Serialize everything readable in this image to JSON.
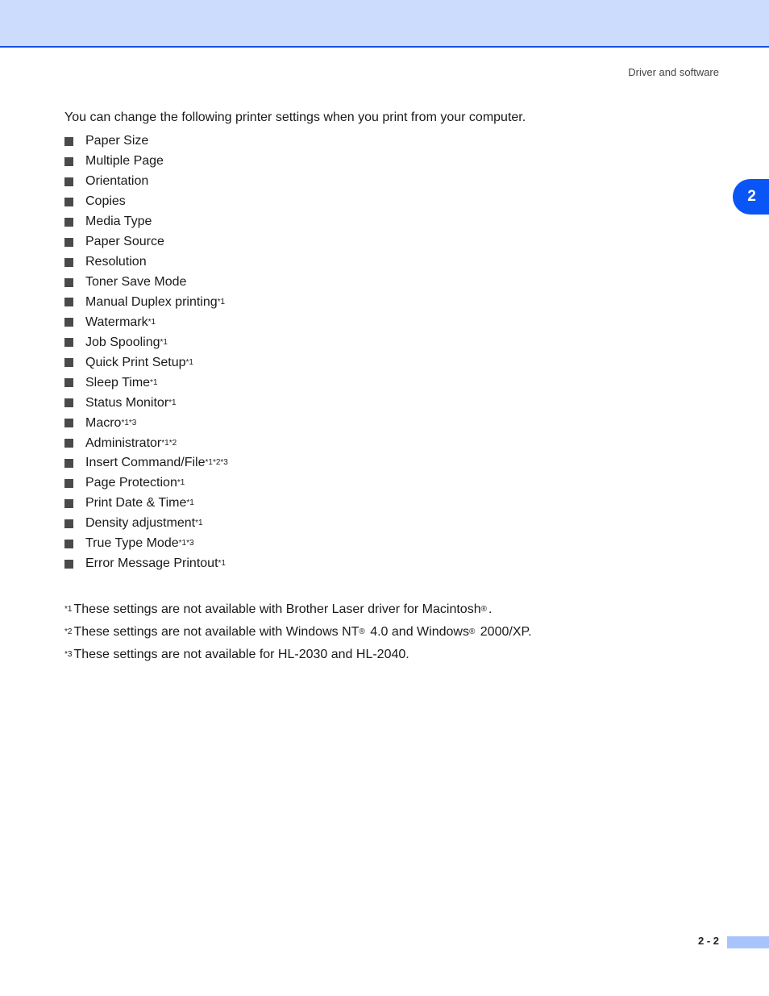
{
  "header": {
    "running_head": "Driver and software",
    "chapter_tab": "2"
  },
  "intro": "You can change the following printer settings when you print from your computer.",
  "settings": [
    {
      "label": "Paper Size",
      "notes": ""
    },
    {
      "label": "Multiple Page",
      "notes": ""
    },
    {
      "label": "Orientation",
      "notes": ""
    },
    {
      "label": "Copies",
      "notes": ""
    },
    {
      "label": "Media Type",
      "notes": ""
    },
    {
      "label": "Paper Source",
      "notes": ""
    },
    {
      "label": "Resolution",
      "notes": ""
    },
    {
      "label": "Toner Save Mode",
      "notes": ""
    },
    {
      "label": "Manual Duplex printing",
      "notes": "*1"
    },
    {
      "label": "Watermark",
      "notes": "*1"
    },
    {
      "label": "Job Spooling",
      "notes": "*1"
    },
    {
      "label": "Quick Print Setup",
      "notes": "*1"
    },
    {
      "label": "Sleep Time",
      "notes": "*1"
    },
    {
      "label": "Status Monitor",
      "notes": "*1"
    },
    {
      "label": "Macro",
      "notes": "*1*3"
    },
    {
      "label": "Administrator",
      "notes": "*1*2"
    },
    {
      "label": "Insert Command/File",
      "notes": "*1*2*3"
    },
    {
      "label": "Page Protection",
      "notes": "*1"
    },
    {
      "label": "Print Date & Time",
      "notes": "*1"
    },
    {
      "label": "Density adjustment",
      "notes": "*1"
    },
    {
      "label": "True Type Mode",
      "notes": "*1*3"
    },
    {
      "label": "Error Message Printout",
      "notes": "*1"
    }
  ],
  "footnotes": [
    {
      "marker": "*1",
      "parts": [
        "These settings are not available with Brother Laser driver for Macintosh",
        "®",
        "."
      ]
    },
    {
      "marker": "*2",
      "parts": [
        "These settings are not available with Windows NT",
        "®",
        " 4.0 and Windows",
        "®",
        " 2000/XP."
      ]
    },
    {
      "marker": "*3",
      "parts": [
        "These settings are not available for HL-2030 and HL-2040."
      ]
    }
  ],
  "footer": {
    "page_number": "2 - 2"
  }
}
